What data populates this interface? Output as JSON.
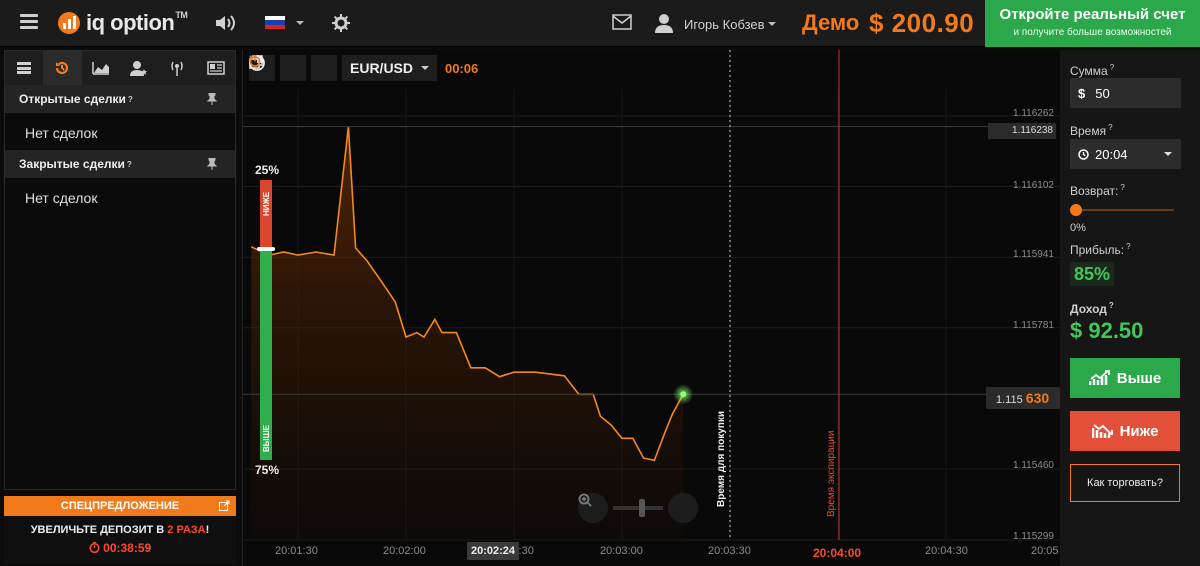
{
  "header": {
    "logo_text": "iq option",
    "logo_tm": "TM",
    "username": "Игорь Кобзев",
    "mode": "Демо",
    "balance": "$ 200.90",
    "real_account_title": "Откройте реальный счет",
    "real_account_subtitle": "и получите больше возможностей"
  },
  "left_panel": {
    "open_deals_title": "Открытые сделки",
    "open_deals_empty": "Нет сделок",
    "closed_deals_title": "Закрытые сделки",
    "closed_deals_empty": "Нет сделок",
    "question_mark": "?"
  },
  "promo": {
    "title": "СПЕЦПРЕДЛОЖЕНИЕ",
    "text_before": "УВЕЛИЧЬТЕ ДЕПОЗИТ В ",
    "text_highlight": "2 РАЗА",
    "text_after": "!",
    "timer": "00:38:59"
  },
  "chart_toolbar": {
    "pair": "EUR/USD",
    "countdown": "00:06"
  },
  "sentiment": {
    "low_pct": "25%",
    "high_pct": "75%",
    "low_label": "НИЖЕ",
    "high_label": "ВЫШЕ",
    "low_share": 0.25
  },
  "chart_labels": {
    "purchase_time": "Время для покупки",
    "expiration_time": "Время экспирации",
    "current_price": "1.116238",
    "last_price_prefix": "1.115",
    "last_price_suffix": "630",
    "price_ticks": [
      "1.116262",
      "1.116102",
      "1.115941",
      "1.115781",
      "1.115460",
      "1.115299"
    ],
    "time_ticks": [
      "20:01:30",
      "20:02:00",
      "20:02:30",
      "20:03:00",
      "20:03:30",
      "20:04:30",
      "20:05"
    ],
    "time_current": "20:02:24",
    "time_expiration": "20:04:00"
  },
  "chart_data": {
    "type": "area",
    "title": "",
    "xlabel": "",
    "ylabel": "",
    "series": [
      {
        "x": [
          "20:01:17",
          "20:01:22",
          "20:01:26",
          "20:01:30",
          "20:01:35",
          "20:01:40",
          "20:01:44",
          "20:01:46",
          "20:01:49",
          "20:01:52",
          "20:01:57",
          "20:02:00",
          "20:02:03",
          "20:02:05",
          "20:02:08",
          "20:02:10",
          "20:02:14",
          "20:02:18",
          "20:02:22",
          "20:02:26",
          "20:02:30",
          "20:02:36",
          "20:02:44",
          "20:02:48",
          "20:02:52",
          "20:02:54",
          "20:02:57",
          "20:03:00",
          "20:03:03",
          "20:03:06",
          "20:03:09",
          "20:03:12",
          "20:03:14",
          "20:03:17"
        ],
        "values": [
          1.115965,
          1.115946,
          1.115953,
          1.115946,
          1.115953,
          1.115946,
          1.116238,
          1.115962,
          1.115935,
          1.1159,
          1.11584,
          1.11576,
          1.11577,
          1.11576,
          1.1158,
          1.11577,
          1.11577,
          1.11569,
          1.11569,
          1.11567,
          1.11568,
          1.11568,
          1.115672,
          1.11563,
          1.11563,
          1.11558,
          1.11556,
          1.11553,
          1.11553,
          1.115485,
          1.11548,
          1.115545,
          1.115585,
          1.11563
        ]
      }
    ],
    "ylim": [
      1.115299,
      1.116262
    ]
  },
  "trade_panel": {
    "amount_label": "Сумма",
    "amount_currency": "$",
    "amount_value": "50",
    "time_label": "Время",
    "time_value": "20:04",
    "return_label": "Возврат:",
    "return_value": "0%",
    "profit_label": "Прибыль:",
    "profit_value": "85%",
    "income_label": "Доход",
    "income_value": "$ 92.50",
    "call_label": "Выше",
    "put_label": "Ниже",
    "how_label": "Как торговать?",
    "question_mark": "?"
  },
  "colors": {
    "accent": "#f27a1a",
    "green": "#2aa84a",
    "red": "#e2503a"
  }
}
